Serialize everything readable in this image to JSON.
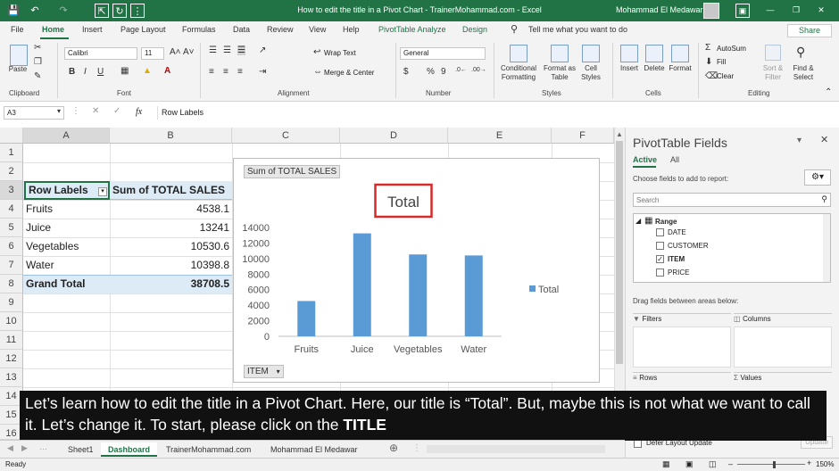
{
  "app": {
    "window_title": "How to edit the title in a Pivot Chart - TrainerMohammad.com  -  Excel",
    "user_name": "Mohammad El Medawar",
    "accent": "#217346"
  },
  "menu": {
    "tabs": [
      "File",
      "Home",
      "Insert",
      "Page Layout",
      "Formulas",
      "Data",
      "Review",
      "View",
      "Help",
      "PivotTable Analyze",
      "Design"
    ],
    "tell_me": "Tell me what you want to do",
    "share": "Share"
  },
  "ribbon": {
    "clipboard": {
      "paste": "Paste",
      "label": "Clipboard"
    },
    "font": {
      "name": "Calibri",
      "size": "11",
      "label": "Font",
      "bold": "B",
      "italic": "I",
      "underline": "U"
    },
    "alignment": {
      "wrap": "Wrap Text",
      "merge": "Merge & Center",
      "label": "Alignment"
    },
    "number": {
      "format": "General",
      "currency": "$",
      "percent": "%",
      "comma": "9",
      "label": "Number"
    },
    "styles": {
      "conditional": [
        "Conditional",
        "Formatting"
      ],
      "format_table": [
        "Format as",
        "Table"
      ],
      "cell_styles": [
        "Cell",
        "Styles"
      ],
      "label": "Styles"
    },
    "cells": {
      "insert": "Insert",
      "delete": "Delete",
      "format": "Format",
      "label": "Cells"
    },
    "editing": {
      "autosum": "AutoSum",
      "fill": "Fill",
      "clear": "Clear",
      "sort": [
        "Sort &",
        "Filter"
      ],
      "find": [
        "Find &",
        "Select"
      ],
      "label": "Editing"
    }
  },
  "formula_bar": {
    "name_box": "A3",
    "fx": "fx",
    "content": "Row Labels"
  },
  "sheet": {
    "columns": [
      "A",
      "B",
      "C",
      "D",
      "E",
      "F"
    ],
    "rows": [
      "1",
      "2",
      "3",
      "4",
      "5",
      "6",
      "7",
      "8",
      "9",
      "10",
      "11",
      "12",
      "13",
      "14",
      "15",
      "16"
    ],
    "header": {
      "a": "Row Labels",
      "b": "Sum of TOTAL SALES"
    },
    "data": [
      {
        "a": "Fruits",
        "b": "4538.1"
      },
      {
        "a": "Juice",
        "b": "13241"
      },
      {
        "a": "Vegetables",
        "b": "10530.6"
      },
      {
        "a": "Water",
        "b": "10398.8"
      }
    ],
    "total": {
      "a": "Grand Total",
      "b": "38708.5"
    }
  },
  "chart": {
    "field_button": "Sum of TOTAL SALES",
    "axis_button": "ITEM",
    "highlight_color": "#d62b2b",
    "bar_color": "#5b9bd5"
  },
  "chart_data": {
    "type": "bar",
    "title": "Total",
    "categories": [
      "Fruits",
      "Juice",
      "Vegetables",
      "Water"
    ],
    "series": [
      {
        "name": "Total",
        "values": [
          4538.1,
          13241,
          10530.6,
          10398.8
        ]
      }
    ],
    "ylim": [
      0,
      14000
    ],
    "yticks": [
      0,
      2000,
      4000,
      6000,
      8000,
      10000,
      12000,
      14000
    ],
    "legend": "right",
    "grid": false
  },
  "pane": {
    "title": "PivotTable Fields",
    "tabs": [
      "Active",
      "All"
    ],
    "choose": "Choose fields to add to report:",
    "search_placeholder": "Search",
    "range": "Range",
    "fields": [
      {
        "name": "DATE",
        "checked": false
      },
      {
        "name": "CUSTOMER",
        "checked": false
      },
      {
        "name": "ITEM",
        "checked": true
      },
      {
        "name": "PRICE",
        "checked": false
      }
    ],
    "drag": "Drag fields between areas below:",
    "areas": {
      "filters": "Filters",
      "columns": "Columns",
      "rows": "Rows",
      "values": "Values"
    },
    "defer": "Defer Layout Update",
    "update": "Update"
  },
  "caption": {
    "text": "Let’s learn how to edit the title in a Pivot Chart. Here, our title is “Total”. But, maybe this is not what we want to call it. Let’s change it. To start, please click on the ",
    "bold": "TITLE"
  },
  "sheet_tabs": [
    "Sheet1",
    "Dashboard",
    "TrainerMohammad.com",
    "Mohammad El Medawar"
  ],
  "active_sheet_index": 1,
  "status": {
    "ready": "Ready",
    "zoom": "150%"
  }
}
